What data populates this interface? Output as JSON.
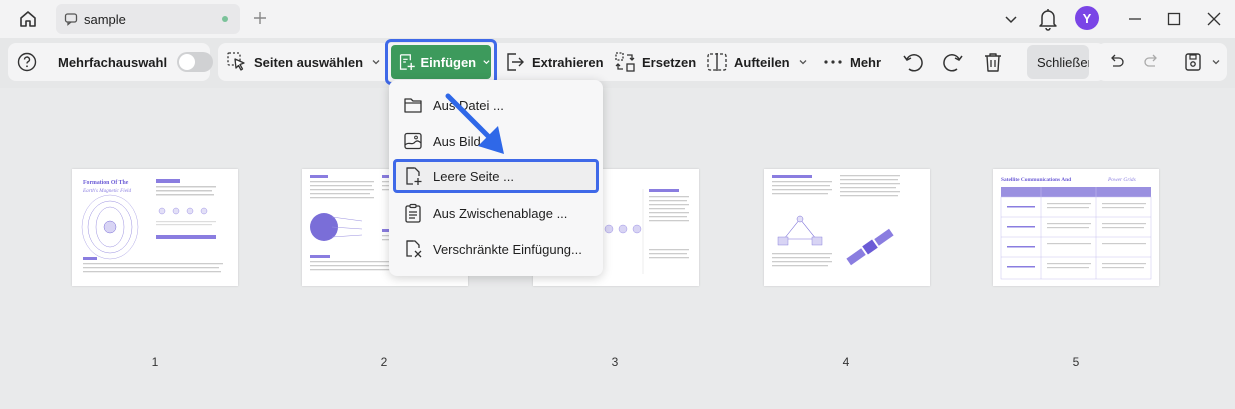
{
  "window": {
    "tab_title": "sample",
    "avatar_initial": "Y"
  },
  "toolbar": {
    "multi_select_label": "Mehrfachauswahl",
    "select_pages_label": "Seiten auswählen",
    "insert_label": "Einfügen",
    "extract_label": "Extrahieren",
    "replace_label": "Ersetzen",
    "split_label": "Aufteilen",
    "more_label": "Mehr",
    "close_label": "Schließen"
  },
  "insert_menu": {
    "items": [
      {
        "label": "Aus Datei ...",
        "icon": "folder-icon"
      },
      {
        "label": "Aus Bild ...",
        "icon": "image-icon"
      },
      {
        "label": "Leere Seite ...",
        "icon": "blank-page-icon",
        "highlighted": true
      },
      {
        "label": "Aus Zwischenablage ...",
        "icon": "clipboard-icon"
      },
      {
        "label": "Verschränkte Einfügung...",
        "icon": "interleave-icon"
      }
    ]
  },
  "pages": [
    {
      "number": "1",
      "title": "Formation Of The",
      "subtitle": "Earth's Magnetic Field"
    },
    {
      "number": "2"
    },
    {
      "number": "3"
    },
    {
      "number": "4"
    },
    {
      "number": "5",
      "title": "Satellite Communications And",
      "subtitle": "Power Grids"
    }
  ],
  "colors": {
    "accent_blue": "#3f69e8",
    "insert_green": "#3d9a5c",
    "avatar_purple": "#7a45e6",
    "doc_purple": "#6b5bd6"
  }
}
